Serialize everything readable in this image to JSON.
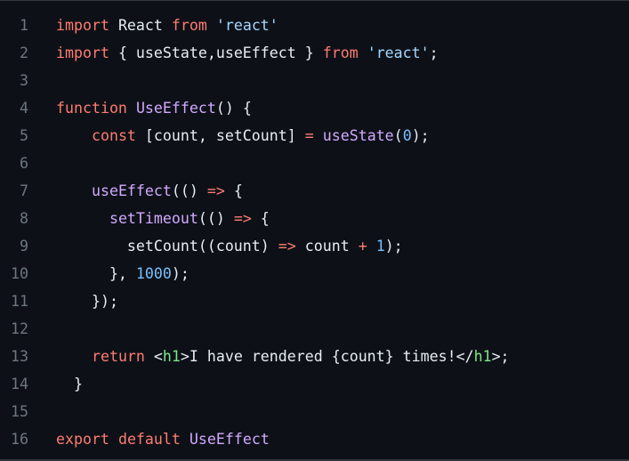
{
  "editor": {
    "language": "javascript",
    "colors": {
      "background": "#0d1117",
      "line_number": "#6e7681",
      "text": "#e6edf3",
      "keyword": "#ff7b72",
      "string": "#a5d6ff",
      "number": "#79c0ff",
      "function": "#d2a8ff",
      "tag": "#7ee787"
    },
    "lines": [
      {
        "number": "1",
        "tokens": [
          {
            "t": "import",
            "c": "kw"
          },
          {
            "t": " React ",
            "c": "punc"
          },
          {
            "t": "from",
            "c": "kw"
          },
          {
            "t": " ",
            "c": "punc"
          },
          {
            "t": "'react'",
            "c": "str"
          }
        ]
      },
      {
        "number": "2",
        "tokens": [
          {
            "t": "import",
            "c": "kw"
          },
          {
            "t": " { useState,useEffect } ",
            "c": "punc"
          },
          {
            "t": "from",
            "c": "kw"
          },
          {
            "t": " ",
            "c": "punc"
          },
          {
            "t": "'react'",
            "c": "str"
          },
          {
            "t": ";",
            "c": "punc"
          }
        ]
      },
      {
        "number": "3",
        "tokens": []
      },
      {
        "number": "4",
        "tokens": [
          {
            "t": "function",
            "c": "kw"
          },
          {
            "t": " ",
            "c": "punc"
          },
          {
            "t": "UseEffect",
            "c": "fn"
          },
          {
            "t": "() {",
            "c": "punc"
          }
        ]
      },
      {
        "number": "5",
        "tokens": [
          {
            "t": "    ",
            "c": "punc"
          },
          {
            "t": "const",
            "c": "kw"
          },
          {
            "t": " [count, setCount] ",
            "c": "punc"
          },
          {
            "t": "=",
            "c": "kw"
          },
          {
            "t": " ",
            "c": "punc"
          },
          {
            "t": "useState",
            "c": "fn"
          },
          {
            "t": "(",
            "c": "punc"
          },
          {
            "t": "0",
            "c": "num"
          },
          {
            "t": ");",
            "c": "punc"
          }
        ]
      },
      {
        "number": "6",
        "tokens": []
      },
      {
        "number": "7",
        "tokens": [
          {
            "t": "    ",
            "c": "punc"
          },
          {
            "t": "useEffect",
            "c": "fn"
          },
          {
            "t": "(() ",
            "c": "punc"
          },
          {
            "t": "=>",
            "c": "kw"
          },
          {
            "t": " {",
            "c": "punc"
          }
        ]
      },
      {
        "number": "8",
        "tokens": [
          {
            "t": "      ",
            "c": "punc"
          },
          {
            "t": "setTimeout",
            "c": "fn"
          },
          {
            "t": "(() ",
            "c": "punc"
          },
          {
            "t": "=>",
            "c": "kw"
          },
          {
            "t": " {",
            "c": "punc"
          }
        ]
      },
      {
        "number": "9",
        "tokens": [
          {
            "t": "        setCount((count) ",
            "c": "punc"
          },
          {
            "t": "=>",
            "c": "kw"
          },
          {
            "t": " count ",
            "c": "punc"
          },
          {
            "t": "+",
            "c": "kw"
          },
          {
            "t": " ",
            "c": "punc"
          },
          {
            "t": "1",
            "c": "num"
          },
          {
            "t": ");",
            "c": "punc"
          }
        ]
      },
      {
        "number": "10",
        "tokens": [
          {
            "t": "      }, ",
            "c": "punc"
          },
          {
            "t": "1000",
            "c": "num"
          },
          {
            "t": ");",
            "c": "punc"
          }
        ]
      },
      {
        "number": "11",
        "tokens": [
          {
            "t": "    });",
            "c": "punc"
          }
        ]
      },
      {
        "number": "12",
        "tokens": []
      },
      {
        "number": "13",
        "tokens": [
          {
            "t": "    ",
            "c": "punc"
          },
          {
            "t": "return",
            "c": "kw"
          },
          {
            "t": " <",
            "c": "punc"
          },
          {
            "t": "h1",
            "c": "tag"
          },
          {
            "t": ">I have rendered {count} times!</",
            "c": "punc"
          },
          {
            "t": "h1",
            "c": "tag"
          },
          {
            "t": ">;",
            "c": "punc"
          }
        ]
      },
      {
        "number": "14",
        "tokens": [
          {
            "t": "  }",
            "c": "punc"
          }
        ]
      },
      {
        "number": "15",
        "tokens": []
      },
      {
        "number": "16",
        "tokens": [
          {
            "t": "export",
            "c": "kw"
          },
          {
            "t": " ",
            "c": "punc"
          },
          {
            "t": "default",
            "c": "kw"
          },
          {
            "t": " ",
            "c": "punc"
          },
          {
            "t": "UseEffect",
            "c": "fn"
          }
        ]
      }
    ]
  }
}
